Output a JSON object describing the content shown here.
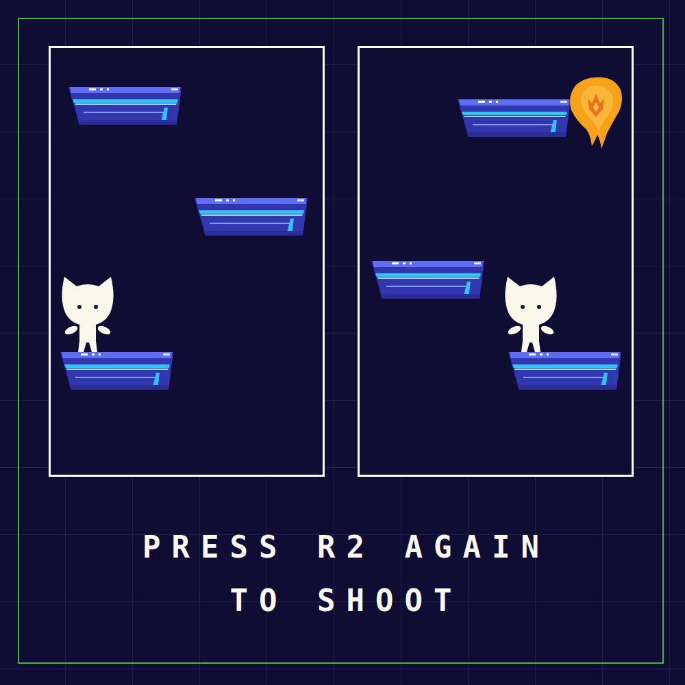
{
  "panels": [
    {
      "entities": [
        {
          "kind": "platform"
        },
        {
          "kind": "platform"
        },
        {
          "kind": "platform"
        },
        {
          "kind": "cat"
        }
      ]
    },
    {
      "entities": [
        {
          "kind": "platform"
        },
        {
          "kind": "fireball"
        },
        {
          "kind": "platform"
        },
        {
          "kind": "platform"
        },
        {
          "kind": "cat"
        }
      ]
    }
  ],
  "caption": [
    "PRESS R2 AGAIN",
    "TO SHOOT"
  ]
}
